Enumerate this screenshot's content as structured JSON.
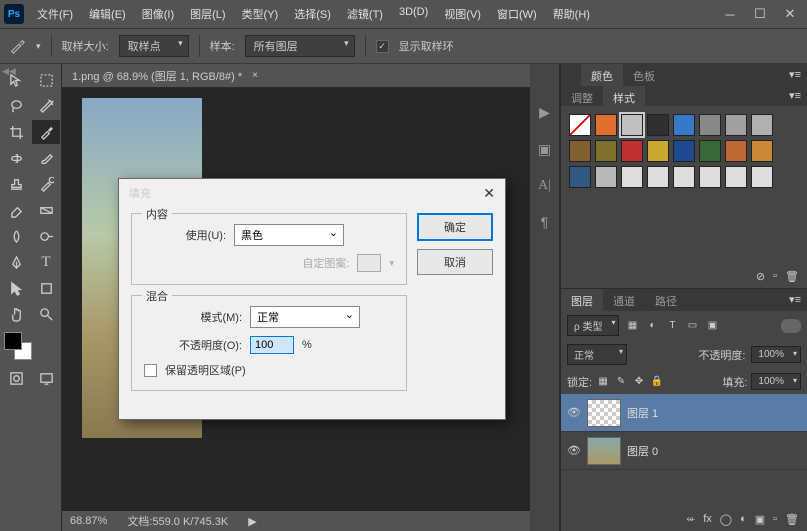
{
  "app": {
    "logo": "Ps"
  },
  "menu": [
    "文件(F)",
    "编辑(E)",
    "图像(I)",
    "图层(L)",
    "类型(Y)",
    "选择(S)",
    "滤镜(T)",
    "3D(D)",
    "视图(V)",
    "窗口(W)",
    "帮助(H)"
  ],
  "options": {
    "sample_size_label": "取样大小:",
    "sample_size_value": "取样点",
    "sample_label": "样本:",
    "sample_value": "所有图层",
    "show_ring_label": "显示取样环",
    "show_ring_checked": "✓"
  },
  "doc": {
    "tab_title": "1.png @ 68.9% (图层 1, RGB/8#) *",
    "zoom": "68.87%",
    "status": "文档:559.0 K/745.3K"
  },
  "dialog": {
    "title": "填充",
    "ok": "确定",
    "cancel": "取消",
    "content_legend": "内容",
    "use_label": "使用(U):",
    "use_value": "黑色",
    "custom_pattern_label": "自定图案:",
    "blend_legend": "混合",
    "mode_label": "模式(M):",
    "mode_value": "正常",
    "opacity_label": "不透明度(O):",
    "opacity_value": "100",
    "opacity_pct": "%",
    "preserve_label": "保留透明区域(P)"
  },
  "panels": {
    "color_tab": "颜色",
    "swatches_tab": "色板",
    "adjust_tab": "调整",
    "styles_tab": "样式",
    "layers_tab": "图层",
    "channels_tab": "通道",
    "paths_tab": "路径",
    "kind_label": "ρ 类型",
    "blend_mode": "正常",
    "opacity_label": "不透明度:",
    "opacity_value": "100%",
    "lock_label": "锁定:",
    "fill_label": "填充:",
    "fill_value": "100%",
    "layer1": "图层 1",
    "layer0": "图层 0"
  },
  "swatch_colors": [
    "#d04040",
    "#e07030",
    "#c0c0c0",
    "#303030",
    "#3878c8",
    "#888",
    "#a0a0a0",
    "#b0b0b0",
    "#806030",
    "#807030",
    "#c03030",
    "#c8a830",
    "#204890",
    "#386838",
    "#c06838",
    "#c88838",
    "#305880",
    "#b8b8b8",
    "#ddd",
    "#ddd",
    "#ddd",
    "#ddd",
    "#ddd",
    "#ddd"
  ],
  "swatch_first_diag": true
}
